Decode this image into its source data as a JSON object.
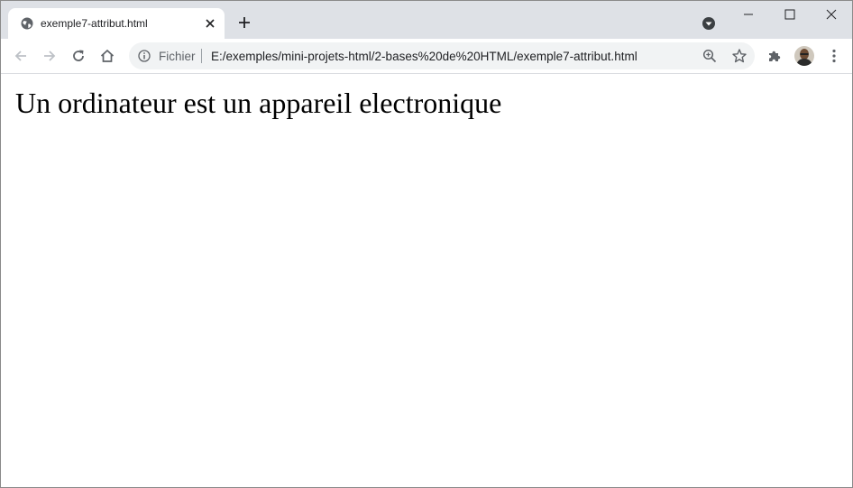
{
  "tab": {
    "title": "exemple7-attribut.html",
    "favicon": "globe-icon",
    "close_icon": "close-icon"
  },
  "tabstrip": {
    "new_tab_icon": "plus-icon",
    "tab_search_icon": "tab-search-icon"
  },
  "window_controls": {
    "minimize_icon": "minimize-icon",
    "maximize_icon": "maximize-icon",
    "close_icon": "close-icon"
  },
  "toolbar": {
    "back_icon": "back-arrow-icon",
    "forward_icon": "forward-arrow-icon",
    "reload_icon": "reload-icon",
    "home_icon": "home-icon",
    "extensions_icon": "puzzle-icon",
    "menu_icon": "kebab-menu-icon",
    "profile_icon": "avatar"
  },
  "omnibox": {
    "security_label": "Fichier",
    "url": "E:/exemples/mini-projets-html/2-bases%20de%20HTML/exemple7-attribut.html",
    "info_icon": "info-icon",
    "zoom_icon": "zoom-icon",
    "bookmark_icon": "star-icon"
  },
  "page": {
    "text": "Un ordinateur est un appareil electronique"
  },
  "colors": {
    "tabstrip_bg": "#dee1e6",
    "omnibox_bg": "#f1f3f4",
    "icon_gray": "#5f6368"
  }
}
